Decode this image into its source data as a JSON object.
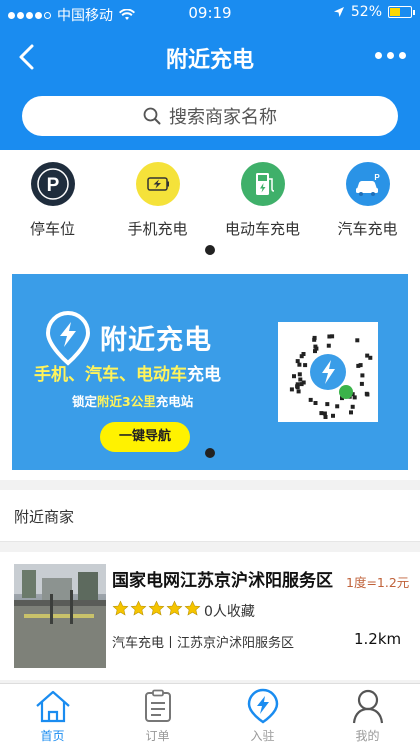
{
  "status_bar": {
    "carrier": "中国移动",
    "time": "09:19",
    "battery": "52%",
    "battery_level": 0.52
  },
  "navbar": {
    "title": "附近充电"
  },
  "search": {
    "placeholder": "搜索商家名称"
  },
  "categories": [
    {
      "label": "停车位",
      "icon": "parking-icon",
      "color": "#1f2d3d"
    },
    {
      "label": "手机充电",
      "icon": "phone-charge-icon",
      "color": "#f5e23a"
    },
    {
      "label": "电动车充电",
      "icon": "ev-charge-icon",
      "color": "#3fb06a"
    },
    {
      "label": "汽车充电",
      "icon": "car-charge-icon",
      "color": "#2a93e6"
    }
  ],
  "banner": {
    "title": "附近充电",
    "subtitle_parts": [
      "手机、汽车、电动车",
      "充电"
    ],
    "line_parts": [
      "锁定",
      "附近3公里",
      "充电站"
    ],
    "button": "一键导航"
  },
  "nearby": {
    "heading": "附近商家",
    "merchants": [
      {
        "name": "国家电网江苏京沪沭阳服务区",
        "price": "1度=1.2元",
        "rating": 5,
        "favorites": "0人收藏",
        "desc": "汽车充电丨江苏京沪沭阳服务区",
        "distance": "1.2km"
      }
    ]
  },
  "tabbar": {
    "items": [
      {
        "label": "首页",
        "icon": "home-icon",
        "active": true
      },
      {
        "label": "订单",
        "icon": "order-icon",
        "active": false
      },
      {
        "label": "入驻",
        "icon": "join-icon",
        "active": false
      },
      {
        "label": "我的",
        "icon": "profile-icon",
        "active": false
      }
    ]
  },
  "colors": {
    "primary": "#1a8cf0",
    "banner_bg": "#3a9de8",
    "price": "#c0623a",
    "star": "#f5c400"
  }
}
